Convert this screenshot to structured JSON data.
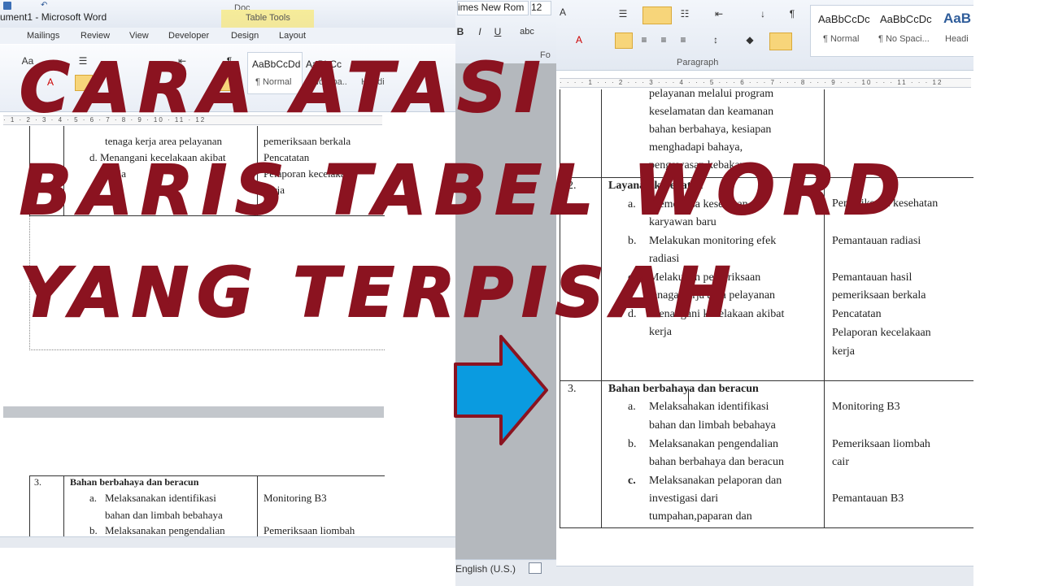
{
  "left_window": {
    "title": "ument1 - Microsoft Word",
    "tabs": [
      "Mailings",
      "Review",
      "View",
      "Developer",
      "Design",
      "Layout"
    ],
    "table_tools": "Table Tools",
    "doc_label": "Doc",
    "styles": [
      "AaBbCcDd",
      "AaBbCc"
    ],
    "style_captions": [
      "¶ Normal",
      "No Spa..",
      "Headi"
    ],
    "ruler_text": "· 1 · 2 · 3 · 4 · 5 · 6 · 7 · 8 · 9 · 10 · 11 · 12",
    "top_rows": [
      {
        "left": "tenaga kerja area pelayanan",
        "right": "pemeriksaan berkala"
      },
      {
        "left": "d.  Menangani kecelakaan akibat",
        "right": "Pencatatan"
      },
      {
        "left": "kerja",
        "right": "Pelaporan kecelakaan"
      },
      {
        "left": "",
        "right": "kerja"
      }
    ],
    "bottom_table": {
      "num": "3.",
      "heading": "Bahan berbahaya dan beracun",
      "items": [
        {
          "label": "a.",
          "text": "Melaksanakan identifikasi",
          "right": "Monitoring B3"
        },
        {
          "label": "",
          "text": "bahan dan limbah bebahaya",
          "right": ""
        },
        {
          "label": "b.",
          "text": "Melaksanakan pengendalian",
          "right": "Pemeriksaan liombah"
        }
      ]
    }
  },
  "middle": {
    "font_name": "imes New Rom",
    "font_size": "12",
    "status_language": "English (U.S.)",
    "font_group": "Fo"
  },
  "right_window": {
    "styles": [
      {
        "sample": "AaBbCcDc",
        "caption": "¶ Normal"
      },
      {
        "sample": "AaBbCcDc",
        "caption": "¶ No Spaci..."
      },
      {
        "sample": "AaB",
        "caption": "Headi"
      }
    ],
    "paragraph_group": "Paragraph",
    "ruler_text": "· · · · 1 · · · 2 · · · 3 · · · 4 · · · 5 · · · 6 · · · 7 · · · 8 · · · 9 · · · 10 · · · 11 · · · 12",
    "row1_lines": [
      "pelayanan melalui program",
      "keselamatan dan keamanan",
      "bahan berbahaya, kesiapan",
      "menghadapi bahaya,",
      "pengawasan kebakaran"
    ],
    "row2": {
      "num": "2.",
      "heading": "Layanan kesehatan",
      "left_lines": [
        {
          "label": "a.",
          "text": "Memeriksa kesehatan"
        },
        {
          "label": "",
          "text": "karyawan baru"
        },
        {
          "label": "b.",
          "text": "Melakukan monitoring efek"
        },
        {
          "label": "",
          "text": "radiasi"
        },
        {
          "label": "c.",
          "text": "Melakukan pemeriksaan"
        },
        {
          "label": "",
          "text": "tenaga kerja area pelayanan"
        },
        {
          "label": "d.",
          "text": "Menangani kecelakaan akibat"
        },
        {
          "label": "",
          "text": "kerja"
        }
      ],
      "right_lines": [
        "Pemeriksaan kesehatan",
        "Pemantauan radiasi",
        "Pemantauan hasil",
        "pemeriksaan berkala",
        "Pencatatan",
        "Pelaporan kecelakaan",
        "kerja"
      ]
    },
    "row3": {
      "num": "3.",
      "heading": "Bahan berbahaya dan beracun",
      "left_lines": [
        {
          "label": "a.",
          "text": "Melaksanakan identifikasi"
        },
        {
          "label": "",
          "text": "bahan dan limbah bebahaya"
        },
        {
          "label": "b.",
          "text": "Melaksanakan pengendalian"
        },
        {
          "label": "",
          "text": "bahan berbahaya dan beracun"
        },
        {
          "label": "c.",
          "text": "Melaksanakan pelaporan dan"
        },
        {
          "label": "",
          "text": "investigasi dari"
        },
        {
          "label": "",
          "text": "tumpahan,paparan dan"
        }
      ],
      "right_lines": [
        "Monitoring B3",
        "Pemeriksaan liombah",
        "cair",
        "Pemantauan B3"
      ]
    }
  },
  "overlay": {
    "line1": "CARA ATASI",
    "line2": "BARIS TABEL WORD",
    "line3": "YANG TERPISAH",
    "text_color": "#8b1320",
    "arrow_color": "#0a9be0"
  }
}
